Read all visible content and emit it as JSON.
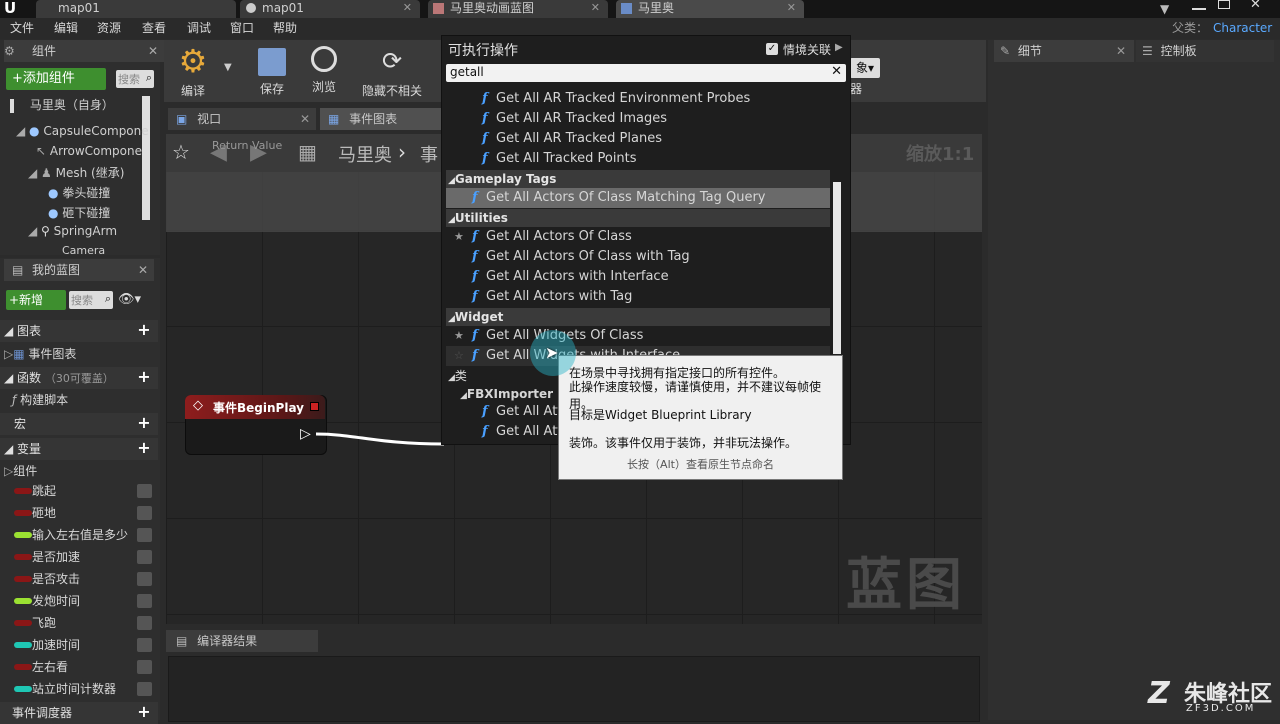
{
  "tabs": [
    {
      "label": "map01",
      "icon": "unreal-logo"
    },
    {
      "label": "map01",
      "icon": "level-icon"
    },
    {
      "label": "马里奥动画蓝图",
      "icon": "anim-blueprint-icon"
    },
    {
      "label": "马里奥",
      "icon": "blueprint-icon"
    }
  ],
  "menu": [
    "文件",
    "编辑",
    "资源",
    "查看",
    "调试",
    "窗口",
    "帮助"
  ],
  "parent_label": "父类：",
  "parent_class": "Character",
  "components_panel": {
    "title": "组件",
    "add_button": "+添加组件",
    "search_placeholder": "搜索",
    "root": "马里奥（自身）",
    "items": [
      "CapsuleCompone",
      "ArrowCompone",
      "Mesh (继承)",
      "拳头碰撞",
      "砸下碰撞",
      "SpringArm",
      "Camera"
    ]
  },
  "my_blueprint": {
    "title": "我的蓝图",
    "new_button": "+新增",
    "search_placeholder": "搜索",
    "sections": {
      "graphs": "图表",
      "event_graph": "事件图表",
      "functions": "函数",
      "functions_hint": "（30可覆盖）",
      "construction_script": "构建脚本",
      "macros": "宏",
      "variables": "变量",
      "components": "组件",
      "event_dispatchers": "事件调度器"
    },
    "variables": [
      {
        "name": "跳起",
        "color": "#8a1616"
      },
      {
        "name": "砸地",
        "color": "#8a1616"
      },
      {
        "name": "输入左右值是多少",
        "color": "#9be132"
      },
      {
        "name": "是否加速",
        "color": "#8a1616"
      },
      {
        "name": "是否攻击",
        "color": "#8a1616"
      },
      {
        "name": "发炮时间",
        "color": "#9be132"
      },
      {
        "name": "飞跑",
        "color": "#8a1616"
      },
      {
        "name": "加速时间",
        "color": "#1fc7b4"
      },
      {
        "name": "左右看",
        "color": "#8a1616"
      },
      {
        "name": "站立时间计数器",
        "color": "#1fc7b4"
      }
    ]
  },
  "toolbar": {
    "compile": "编译",
    "save": "保存",
    "browse": "浏览",
    "hide_unrelated": "隐藏不相关",
    "find_suffix": "象",
    "debugger_suffix": "器"
  },
  "editor_tabs": {
    "viewport": "视口",
    "event_graph": "事件图表"
  },
  "graph": {
    "breadcrumb": [
      "马里奥",
      "事"
    ],
    "zoom": "缩放1:1",
    "watermark": "蓝图",
    "ghost_text": "Return Value",
    "event_node": "事件BeginPlay"
  },
  "compiler_results": {
    "title": "编译器结果"
  },
  "details_panel": {
    "title": "细节"
  },
  "palette_panel": {
    "title": "控制板"
  },
  "action_menu": {
    "title": "可执行操作",
    "context_sensitive": "情境关联",
    "search_value": "getall",
    "rows": [
      {
        "type": "fn",
        "label": "Get All AR Tracked Environment Probes",
        "indent": 2
      },
      {
        "type": "fn",
        "label": "Get All AR Tracked Images",
        "indent": 2
      },
      {
        "type": "fn",
        "label": "Get All AR Tracked Planes",
        "indent": 2
      },
      {
        "type": "fn",
        "label": "Get All Tracked Points",
        "indent": 2
      },
      {
        "type": "cat",
        "label": "Gameplay Tags"
      },
      {
        "type": "fn",
        "label": "Get All Actors Of Class Matching Tag Query",
        "indent": 1,
        "selected": true
      },
      {
        "type": "cat",
        "label": "Utilities"
      },
      {
        "type": "fn",
        "label": "Get All Actors Of Class",
        "indent": 1,
        "star": true
      },
      {
        "type": "fn",
        "label": "Get All Actors Of Class with Tag",
        "indent": 1
      },
      {
        "type": "fn",
        "label": "Get All Actors with Interface",
        "indent": 1
      },
      {
        "type": "fn",
        "label": "Get All Actors with Tag",
        "indent": 1
      },
      {
        "type": "cat",
        "label": "Widget"
      },
      {
        "type": "fn",
        "label": "Get All Widgets Of Class",
        "indent": 1,
        "star": true
      },
      {
        "type": "fn",
        "label": "Get All Widgets with Interface",
        "indent": 1,
        "star": true,
        "hover": true
      },
      {
        "type": "plain",
        "label": "类"
      },
      {
        "type": "sub",
        "label": "FBXImporter Utils"
      },
      {
        "type": "fn",
        "label": "Get All Atta",
        "indent": 2
      },
      {
        "type": "fn",
        "label": "Get All Atta",
        "indent": 2
      }
    ]
  },
  "tooltip": {
    "line1": "在场景中寻找拥有指定接口的所有控件。",
    "line2": "此操作速度较慢，请谨慎使用，并不建议每帧使用。",
    "line3": "目标是Widget Blueprint Library",
    "line4": "装饰。该事件仅用于装饰，并非玩法操作。",
    "hint": "长按（Alt）查看原生节点命名"
  },
  "brand": {
    "name": "朱峰社区",
    "url": "ZF3D.COM"
  }
}
